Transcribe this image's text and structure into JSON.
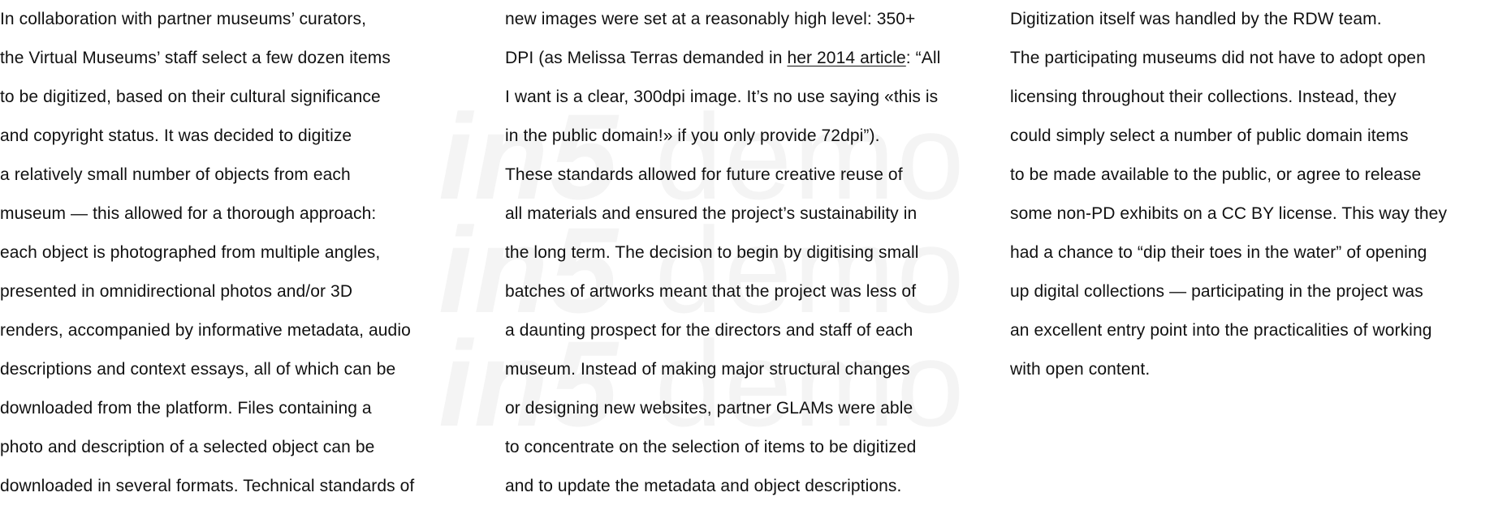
{
  "watermark": {
    "text_bold": "in5",
    "text_light": " demo"
  },
  "columns": [
    {
      "lines": [
        "In collaboration with partner museums’ curators,",
        "the Virtual Museums’ staff select a few dozen items",
        "to be digitized, based on their cultural significance",
        "and copyright status. It was decided to digitize",
        "a relatively small number of objects from each",
        "museum — this allowed for a thorough approach:",
        "each object is photographed from multiple angles,",
        "presented in omnidirectional photos and/or 3D",
        "renders, accompanied by informative metadata, audio",
        "descriptions and context essays, all of which can be",
        "downloaded from the platform. Files containing a",
        "photo and description of a selected object can be",
        "downloaded in several formats. Technical standards of"
      ]
    },
    {
      "line1": "new images were set at a reasonably high level: 350+",
      "line2_before": "DPI (as Melissa Terras demanded in ",
      "line2_link": "her 2014 article",
      "line2_after": ": “All",
      "lines_rest": [
        "I want is a clear, 300dpi image. It’s no use saying «this is",
        "in the public domain!» if you only provide 72dpi”).",
        "These standards allowed for future creative reuse of",
        "all materials and ensured the project’s sustainability in",
        "the long term. The decision to begin by digitising small",
        "batches of artworks meant that the project was less of",
        "a daunting prospect for the directors and staff of each",
        "museum. Instead of making major structural changes",
        "or designing new websites, partner GLAMs were able",
        "to concentrate on the selection of items to be digitized",
        "and to update the metadata and object descriptions."
      ]
    },
    {
      "lines": [
        "Digitization itself was handled by the RDW team.",
        "The participating museums did not have to adopt open",
        "licensing throughout their collections. Instead, they",
        "could simply select a number of public domain items",
        "to be made available to the public, or agree to release",
        "some non-PD exhibits on a CC BY license. This way they",
        "had a chance to “dip their toes in the water” of opening",
        "up digital collections — participating in the project was",
        "an excellent entry point into the practicalities of working",
        "with open content."
      ]
    }
  ]
}
